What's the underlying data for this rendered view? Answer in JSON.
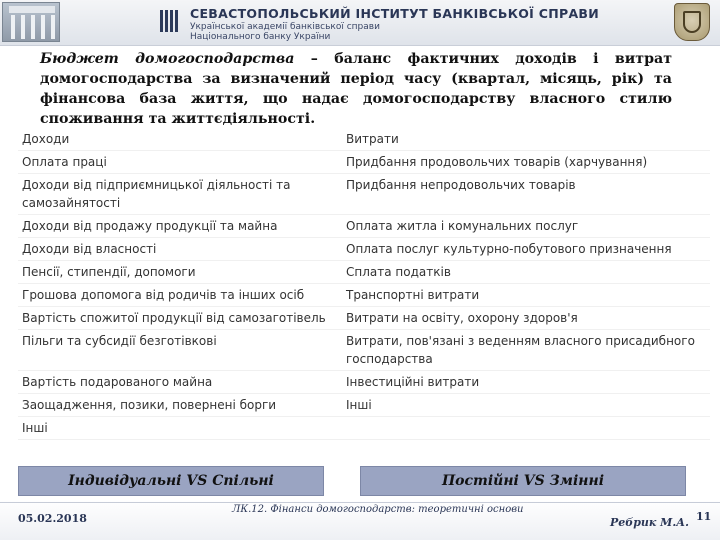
{
  "header": {
    "institute_title": "СЕВАСТОПОЛЬСЬКИЙ ІНСТИТУТ БАНКІВСЬКОЇ СПРАВИ",
    "institute_subtitle_line1": "Української академії банківської справи",
    "institute_subtitle_line2": "Національного банку України"
  },
  "definition": {
    "term": "Бюджет домогосподарства",
    "text": " – баланс фактичних доходів і витрат домогосподарства за визначений період часу (квартал, місяць, рік) та фінансова база життя, що надає домогосподарству власного стилю споживання та життєдіяльності."
  },
  "table": {
    "rows": [
      {
        "left": "Доходи",
        "right": "Витрати"
      },
      {
        "left": "Оплата праці",
        "right": "Придбання продовольчих товарів (харчування)"
      },
      {
        "left": "Доходи від підприємницької діяльності та самозайнятості",
        "right": "Придбання непродовольчих товарів"
      },
      {
        "left": "Доходи від продажу продукції та майна",
        "right": "Оплата житла і комунальних послуг"
      },
      {
        "left": "Доходи від власності",
        "right": "Оплата послуг культурно-побутового призначення"
      },
      {
        "left": "Пенсії, стипендії, допомоги",
        "right": "Сплата податків"
      },
      {
        "left": "Грошова допомога від родичів та інших осіб",
        "right": "Транспортні витрати"
      },
      {
        "left": "Вартість спожитої продукції від самозаготівель",
        "right": "Витрати на освіту, охорону здоров'я"
      },
      {
        "left": "Пільги та субсидії безготівкові",
        "right": "Витрати, пов'язані з веденням власного присадибного господарства"
      },
      {
        "left": "Вартість подарованого майна",
        "right": "Інвестиційні витрати"
      },
      {
        "left": "Заощадження, позики, повернені борги",
        "right": "Інші"
      },
      {
        "left": "Інші",
        "right": ""
      }
    ]
  },
  "footer": {
    "left_box": "Індивідуальні VS Спільні",
    "right_box": "Постійні VS Змінні",
    "date": "05.02.2018",
    "lecture": "ЛК.12. Фінанси домогосподарств: теоретичні основи",
    "author": "Ребрик М.А.",
    "page_number": "11"
  }
}
